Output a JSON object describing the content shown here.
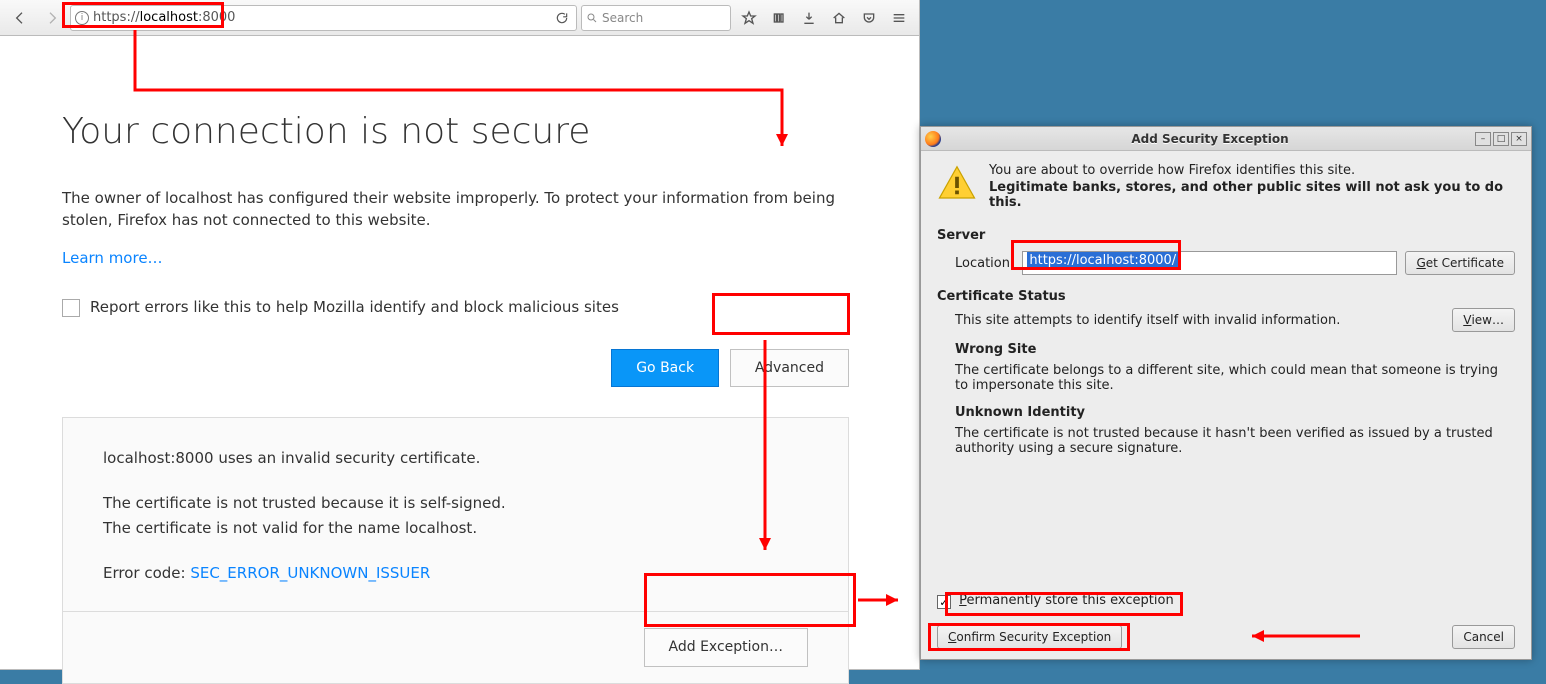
{
  "browser": {
    "url_scheme": "https://",
    "url_host": "localhost",
    "url_port": ":8000",
    "search_placeholder": "Search"
  },
  "error": {
    "title": "Your connection is not secure",
    "body": "The owner of localhost has configured their website improperly. To protect your information from being stolen, Firefox has not connected to this website.",
    "learn_more": "Learn more…",
    "report_cb": "Report errors like this to help Mozilla identify and block malicious sites",
    "go_back": "Go Back",
    "advanced": "Advanced",
    "adv_line1": "localhost:8000 uses an invalid security certificate.",
    "adv_line2": "The certificate is not trusted because it is self-signed.",
    "adv_line3": "The certificate is not valid for the name localhost.",
    "error_code_label": "Error code: ",
    "error_code": "SEC_ERROR_UNKNOWN_ISSUER",
    "add_exception": "Add Exception…"
  },
  "dialog": {
    "title": "Add Security Exception",
    "override_text": "You are about to override how Firefox identifies this site.",
    "warn_bold": "Legitimate banks, stores, and other public sites will not ask you to do this.",
    "server_head": "Server",
    "location_label": "Location:",
    "location_value": "https://localhost:8000/",
    "get_cert": "Get Certificate",
    "cert_status_head": "Certificate Status",
    "cert_status_text": "This site attempts to identify itself with invalid information.",
    "view": "View…",
    "wrong_site_head": "Wrong Site",
    "wrong_site_text": "The certificate belongs to a different site, which could mean that someone is trying to impersonate this site.",
    "unknown_head": "Unknown Identity",
    "unknown_text": "The certificate is not trusted because it hasn't been verified as issued by a trusted authority using a secure signature.",
    "perm_store": "Permanently store this exception",
    "confirm": "Confirm Security Exception",
    "cancel": "Cancel"
  }
}
